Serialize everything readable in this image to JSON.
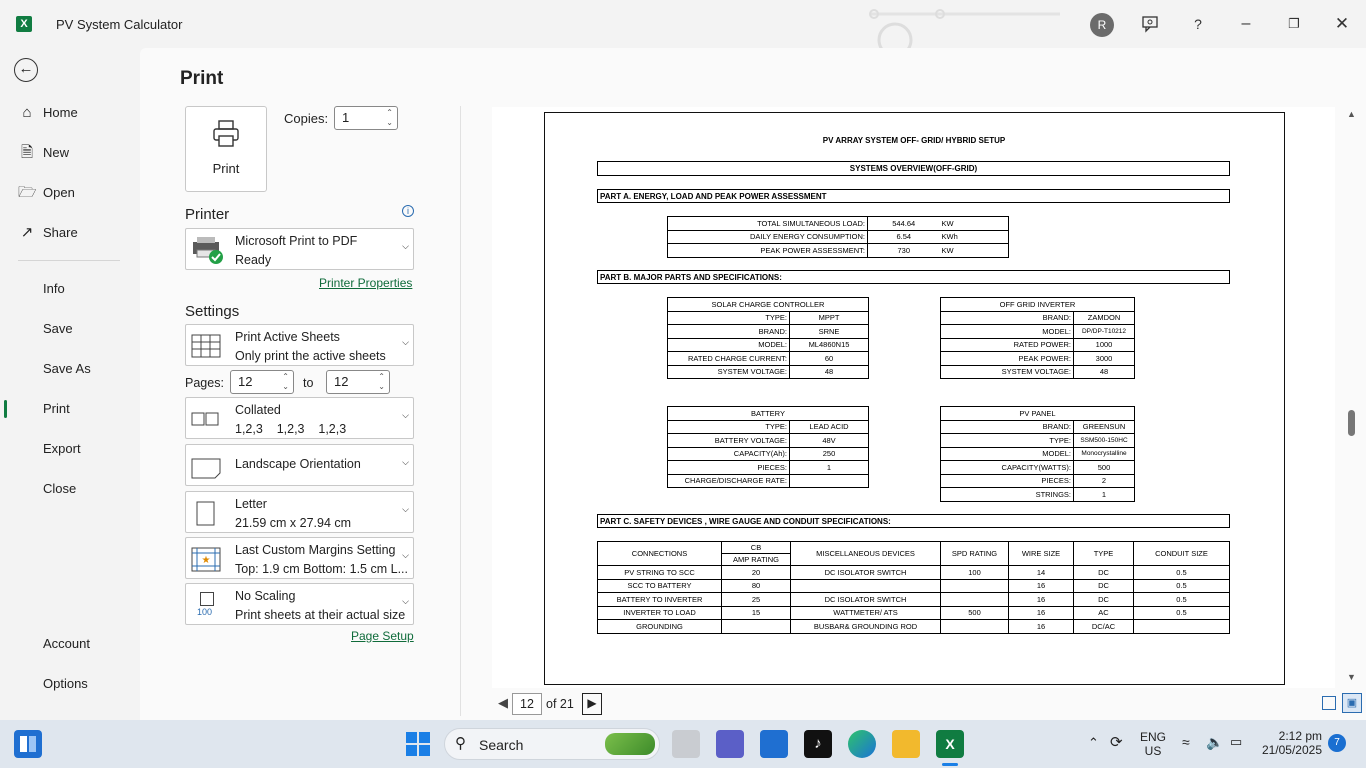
{
  "titlebar": {
    "app_title": "PV System Calculator",
    "avatar_initial": "R",
    "help": "?"
  },
  "nav": {
    "home": "Home",
    "new": "New",
    "open": "Open",
    "share": "Share",
    "info": "Info",
    "save": "Save",
    "save_as": "Save As",
    "print": "Print",
    "export": "Export",
    "close": "Close",
    "account": "Account",
    "options": "Options"
  },
  "print": {
    "heading": "Print",
    "button_label": "Print",
    "copies_label": "Copies:",
    "copies_value": "1"
  },
  "printer": {
    "section": "Printer",
    "name": "Microsoft Print to PDF",
    "status": "Ready",
    "properties_link": "Printer Properties"
  },
  "settings": {
    "section": "Settings",
    "sheets": {
      "l1": "Print Active Sheets",
      "l2": "Only print the active sheets"
    },
    "pages_label": "Pages:",
    "pages_from": "12",
    "to_label": "to",
    "pages_to": "12",
    "collate": {
      "l1": "Collated",
      "l2": "1,2,3    1,2,3    1,2,3"
    },
    "orientation": {
      "l1": "Landscape Orientation"
    },
    "paper": {
      "l1": "Letter",
      "l2": "21.59 cm x 27.94 cm"
    },
    "margins": {
      "l1": "Last Custom Margins Setting",
      "l2": "Top: 1.9 cm Bottom: 1.5 cm L..."
    },
    "scaling": {
      "l1": "No Scaling",
      "l2": "Print sheets at their actual size",
      "icon_text": "100"
    },
    "page_setup_link": "Page Setup"
  },
  "pager": {
    "current": "12",
    "of": "of 21"
  },
  "doc": {
    "title": "PV ARRAY SYSTEM OFF- GRID/ HYBRID SETUP",
    "overview": "SYSTEMS OVERVIEW(OFF-GRID)",
    "part_a": "PART A. ENERGY, LOAD AND PEAK POWER ASSESSMENT",
    "part_b": "PART B. MAJOR PARTS  AND SPECIFICATIONS:",
    "part_c": "PART C. SAFETY DEVICES , WIRE GAUGE AND CONDUIT SPECIFICATIONS:",
    "loads": [
      [
        "TOTAL SIMULTANEOUS LOAD:",
        "544.64",
        "KW"
      ],
      [
        "DAILY ENERGY CONSUMPTION:",
        "6.54",
        "KWh"
      ],
      [
        "PEAK POWER ASSESSMENT:",
        "730",
        "KW"
      ]
    ],
    "scc": {
      "title": "SOLAR CHARGE CONTROLLER",
      "rows": [
        [
          "TYPE:",
          "MPPT"
        ],
        [
          "BRAND:",
          "SRNE"
        ],
        [
          "MODEL:",
          "ML4860N15"
        ],
        [
          "RATED CHARGE CURRENT:",
          "60"
        ],
        [
          "SYSTEM VOLTAGE:",
          "48"
        ]
      ]
    },
    "inverter": {
      "title": "OFF GRID INVERTER",
      "rows": [
        [
          "BRAND:",
          "ZAMDON"
        ],
        [
          "MODEL:",
          "DP/DP-T10212"
        ],
        [
          "RATED POWER:",
          "1000"
        ],
        [
          "PEAK POWER:",
          "3000"
        ],
        [
          "SYSTEM VOLTAGE:",
          "48"
        ]
      ]
    },
    "battery": {
      "title": "BATTERY",
      "rows": [
        [
          "TYPE:",
          "LEAD ACID"
        ],
        [
          "BATTERY VOLTAGE:",
          "48V"
        ],
        [
          "CAPACITY(Ah):",
          "250"
        ],
        [
          "PIECES:",
          "1"
        ],
        [
          "CHARGE/DISCHARGE RATE:",
          ""
        ]
      ]
    },
    "pv_panel": {
      "title": "PV PANEL",
      "rows": [
        [
          "BRAND:",
          "GREENSUN"
        ],
        [
          "TYPE:",
          "SSM500-150HC"
        ],
        [
          "MODEL:",
          "Monocrystalline"
        ],
        [
          "CAPACITY(WATTS):",
          "500"
        ],
        [
          "PIECES:",
          "2"
        ],
        [
          "STRINGS:",
          "1"
        ]
      ]
    },
    "safety_headers": [
      "CONNECTIONS",
      "CB",
      "AMP RATING",
      "MISCELLANEOUS DEVICES",
      "SPD RATING",
      "WIRE SIZE",
      "TYPE",
      "CONDUIT SIZE"
    ],
    "safety_rows": [
      [
        "PV STRING TO SCC",
        "20",
        "DC ISOLATOR SWITCH",
        "100",
        "14",
        "DC",
        "0.5"
      ],
      [
        "SCC  TO BATTERY",
        "80",
        "",
        "",
        "16",
        "DC",
        "0.5"
      ],
      [
        "BATTERY  TO INVERTER",
        "25",
        "DC ISOLATOR SWITCH",
        "",
        "16",
        "DC",
        "0.5"
      ],
      [
        "INVERTER TO LOAD",
        "15",
        "WATTMETER/ ATS",
        "500",
        "16",
        "AC",
        "0.5"
      ],
      [
        "GROUNDING",
        "",
        "BUSBAR& GROUNDING ROD",
        "",
        "16",
        "DC/AC",
        ""
      ]
    ]
  },
  "taskbar": {
    "search": "Search",
    "lang1": "ENG",
    "lang2": "US",
    "time": "2:12 pm",
    "date": "21/05/2025",
    "badge": "7"
  }
}
